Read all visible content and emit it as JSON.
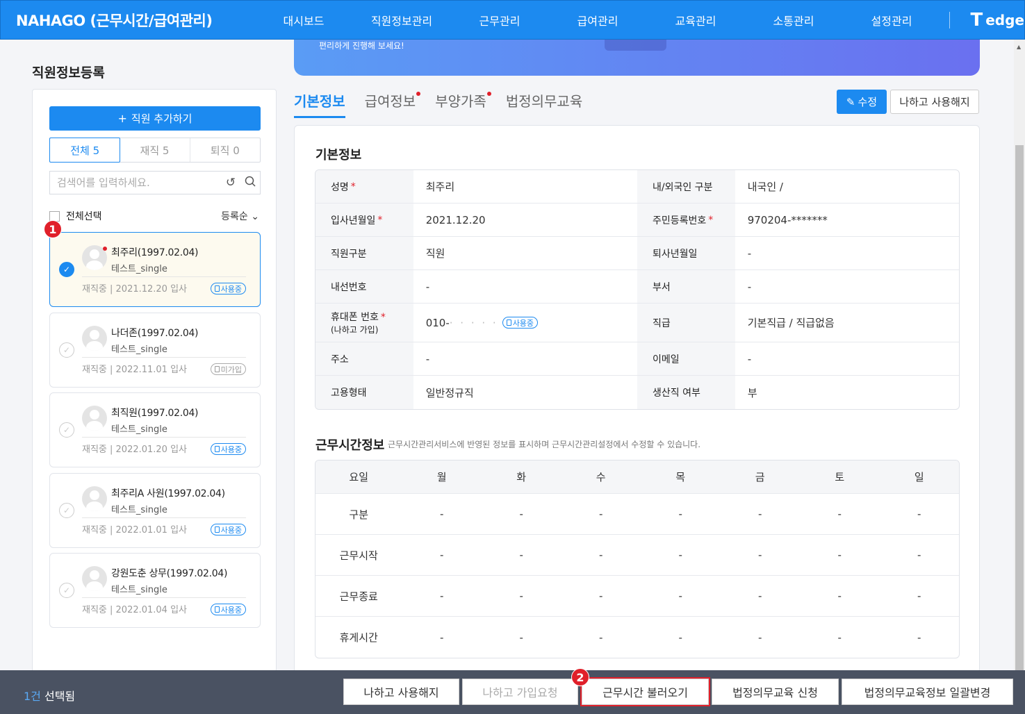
{
  "nav": {
    "brand": "NAHAGO (근무시간/급여관리)",
    "items": [
      "대시보드",
      "직원정보관리",
      "근무관리",
      "급여관리",
      "교육관리",
      "소통관리",
      "설정관리"
    ],
    "logo": "edge"
  },
  "left": {
    "title": "직원정보등록",
    "add_button": "직원 추가하기",
    "tabs": [
      {
        "label": "전체 5"
      },
      {
        "label": "재직 5"
      },
      {
        "label": "퇴직 0"
      }
    ],
    "search_placeholder": "검색어를 입력하세요.",
    "select_all": "전체선택",
    "sort": "등록순",
    "employees": [
      {
        "name": "최주리(1997.02.04)",
        "dept": "테스트_single",
        "meta": "재직중 | 2021.12.20 입사",
        "badge": "사용중"
      },
      {
        "name": "나더존(1997.02.04)",
        "dept": "테스트_single",
        "meta": "재직중 | 2022.11.01 입사",
        "badge": "미가입"
      },
      {
        "name": "최직원(1997.02.04)",
        "dept": "테스트_single",
        "meta": "재직중 | 2022.01.20 입사",
        "badge": "사용중"
      },
      {
        "name": "최주리A 사원(1997.02.04)",
        "dept": "테스트_single",
        "meta": "재직중 | 2022.01.01 입사",
        "badge": "사용중"
      },
      {
        "name": "강원도춘 상무(1997.02.04)",
        "dept": "테스트_single",
        "meta": "재직중 | 2022.01.04 입사",
        "badge": "사용중"
      }
    ]
  },
  "annotations": {
    "one": "1",
    "two": "2"
  },
  "banner": {
    "text": "편리하게 진행해 보세요!"
  },
  "content_tabs": [
    "기본정보",
    "급여정보",
    "부양가족",
    "법정의무교육"
  ],
  "actions": {
    "edit": "수정",
    "unlink": "나하고 사용해지"
  },
  "basic": {
    "title": "기본정보",
    "rows": [
      {
        "l1": "성명",
        "v1": "최주리",
        "l2": "내/외국인 구분",
        "v2": "내국인 /"
      },
      {
        "l1": "입사년월일",
        "v1": "2021.12.20",
        "l2": "주민등록번호",
        "v2": "970204-*******"
      },
      {
        "l1": "직원구분",
        "v1": "직원",
        "l2": "퇴사년월일",
        "v2": "-"
      },
      {
        "l1": "내선번호",
        "v1": "-",
        "l2": "부서",
        "v2": "-"
      },
      {
        "l1": "휴대폰 번호",
        "l1_sub": "(나하고 가입)",
        "v1": "010-",
        "v1_badge": "사용중",
        "l2": "직급",
        "v2": "기본직급 / 직급없음"
      },
      {
        "l1": "주소",
        "v1": "-",
        "l2": "이메일",
        "v2": "-"
      },
      {
        "l1": "고용형태",
        "v1": "일반정규직",
        "l2": "생산직 여부",
        "v2": "부"
      }
    ]
  },
  "work": {
    "title": "근무시간정보",
    "desc": "근무시간관리서비스에 반영된 정보를 표시하며 근무시간관리설정에서 수정할 수 있습니다.",
    "header": [
      "요일",
      "월",
      "화",
      "수",
      "목",
      "금",
      "토",
      "일"
    ],
    "rows": [
      {
        "label": "구분",
        "cells": [
          "-",
          "-",
          "-",
          "-",
          "-",
          "-",
          "-"
        ]
      },
      {
        "label": "근무시작",
        "cells": [
          "-",
          "-",
          "-",
          "-",
          "-",
          "-",
          "-"
        ]
      },
      {
        "label": "근무종료",
        "cells": [
          "-",
          "-",
          "-",
          "-",
          "-",
          "-",
          "-"
        ]
      },
      {
        "label": "휴게시간",
        "cells": [
          "-",
          "-",
          "-",
          "-",
          "-",
          "-",
          "-"
        ]
      }
    ]
  },
  "bottom": {
    "count": "1건",
    "count_suffix": " 선택됨",
    "buttons": [
      "나하고 사용해지",
      "나하고 가입요청",
      "근무시간 불러오기",
      "법정의무교육 신청",
      "법정의무교육정보 일괄변경"
    ]
  }
}
